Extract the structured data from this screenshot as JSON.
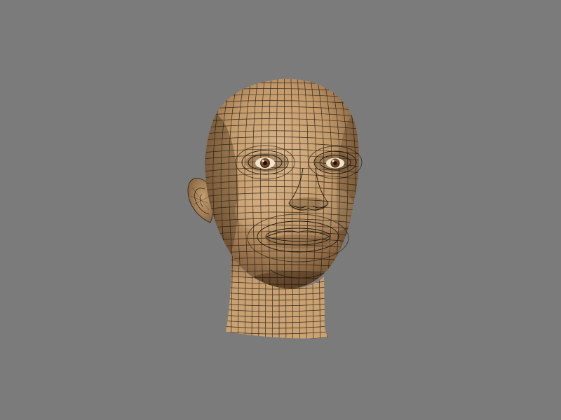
{
  "scene": {
    "background_color": "#7b7b7b",
    "skin_color": "#c49a6c",
    "skin_highlight": "#d9b489",
    "skin_shadow": "#6e4f32",
    "wire_color": "#1e1810",
    "iris_color": "#6b4220",
    "subject": "wireframe-head-model"
  }
}
